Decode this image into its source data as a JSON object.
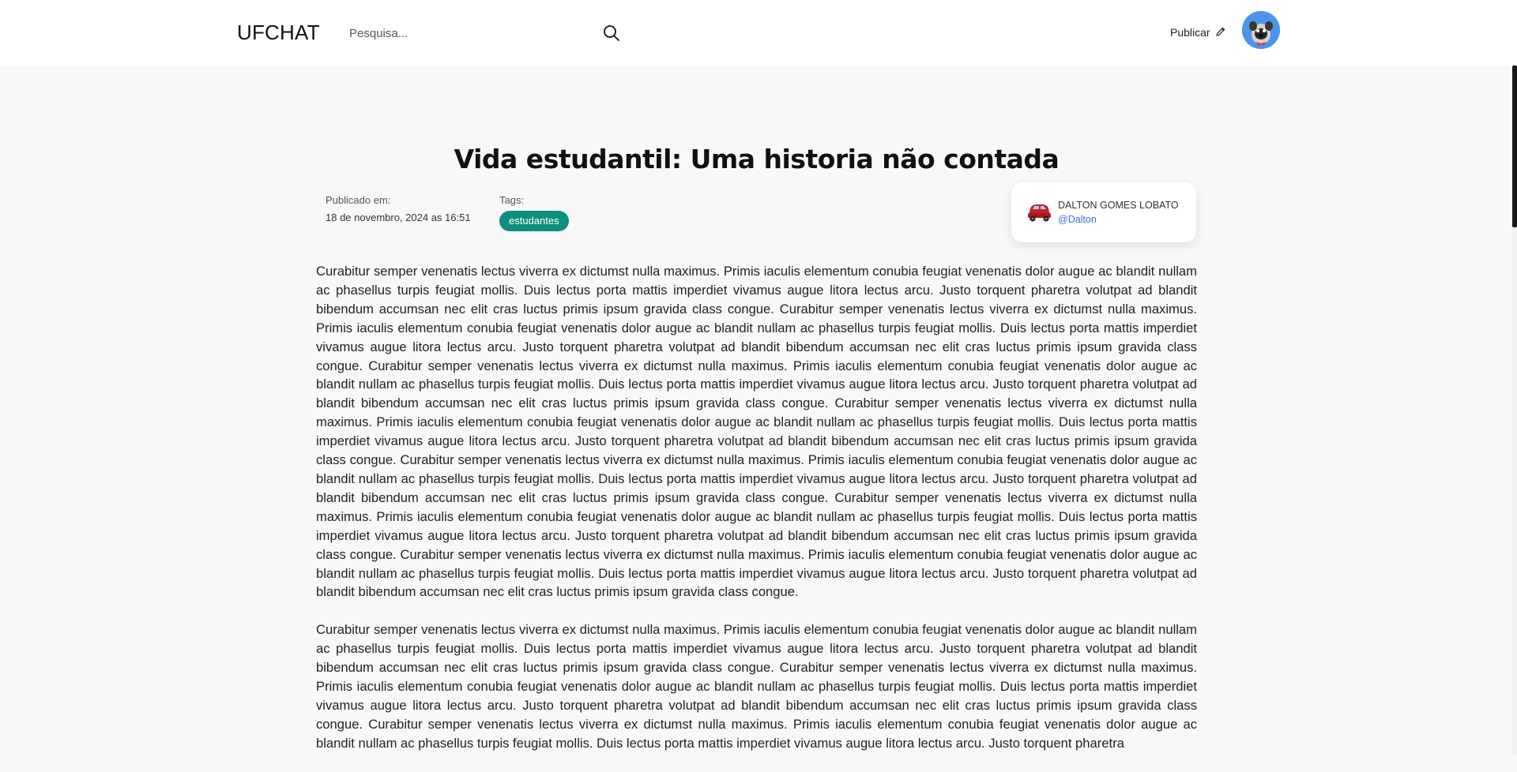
{
  "header": {
    "logo": "UFCHAT",
    "search_placeholder": "Pesquisa...",
    "publish_label": "Publicar"
  },
  "post": {
    "title": "Vida estudantil: Uma historia não contada",
    "published_label": "Publicado em:",
    "published_date": "18 de novembro, 2024 as 16:51",
    "tags_label": "Tags:",
    "tags": [
      "estudantes"
    ],
    "author": {
      "name": "DALTON GOMES LOBATO",
      "handle": "@Dalton"
    },
    "paragraphs": [
      "Curabitur semper venenatis lectus viverra ex dictumst nulla maximus. Primis iaculis elementum conubia feugiat venenatis dolor augue ac blandit nullam ac phasellus turpis feugiat mollis. Duis lectus porta mattis imperdiet vivamus augue litora lectus arcu. Justo torquent pharetra volutpat ad blandit bibendum accumsan nec elit cras luctus primis ipsum gravida class congue. Curabitur semper venenatis lectus viverra ex dictumst nulla maximus. Primis iaculis elementum conubia feugiat venenatis dolor augue ac blandit nullam ac phasellus turpis feugiat mollis. Duis lectus porta mattis imperdiet vivamus augue litora lectus arcu. Justo torquent pharetra volutpat ad blandit bibendum accumsan nec elit cras luctus primis ipsum gravida class congue. Curabitur semper venenatis lectus viverra ex dictumst nulla maximus. Primis iaculis elementum conubia feugiat venenatis dolor augue ac blandit nullam ac phasellus turpis feugiat mollis. Duis lectus porta mattis imperdiet vivamus augue litora lectus arcu. Justo torquent pharetra volutpat ad blandit bibendum accumsan nec elit cras luctus primis ipsum gravida class congue. Curabitur semper venenatis lectus viverra ex dictumst nulla maximus. Primis iaculis elementum conubia feugiat venenatis dolor augue ac blandit nullam ac phasellus turpis feugiat mollis. Duis lectus porta mattis imperdiet vivamus augue litora lectus arcu. Justo torquent pharetra volutpat ad blandit bibendum accumsan nec elit cras luctus primis ipsum gravida class congue. Curabitur semper venenatis lectus viverra ex dictumst nulla maximus. Primis iaculis elementum conubia feugiat venenatis dolor augue ac blandit nullam ac phasellus turpis feugiat mollis. Duis lectus porta mattis imperdiet vivamus augue litora lectus arcu. Justo torquent pharetra volutpat ad blandit bibendum accumsan nec elit cras luctus primis ipsum gravida class congue. Curabitur semper venenatis lectus viverra ex dictumst nulla maximus. Primis iaculis elementum conubia feugiat venenatis dolor augue ac blandit nullam ac phasellus turpis feugiat mollis. Duis lectus porta mattis imperdiet vivamus augue litora lectus arcu. Justo torquent pharetra volutpat ad blandit bibendum accumsan nec elit cras luctus primis ipsum gravida class congue. Curabitur semper venenatis lectus viverra ex dictumst nulla maximus. Primis iaculis elementum conubia feugiat venenatis dolor augue ac blandit nullam ac phasellus turpis feugiat mollis. Duis lectus porta mattis imperdiet vivamus augue litora lectus arcu. Justo torquent pharetra volutpat ad blandit bibendum accumsan nec elit cras luctus primis ipsum gravida class congue.",
      "Curabitur semper venenatis lectus viverra ex dictumst nulla maximus. Primis iaculis elementum conubia feugiat venenatis dolor augue ac blandit nullam ac phasellus turpis feugiat mollis. Duis lectus porta mattis imperdiet vivamus augue litora lectus arcu. Justo torquent pharetra volutpat ad blandit bibendum accumsan nec elit cras luctus primis ipsum gravida class congue. Curabitur semper venenatis lectus viverra ex dictumst nulla maximus. Primis iaculis elementum conubia feugiat venenatis dolor augue ac blandit nullam ac phasellus turpis feugiat mollis. Duis lectus porta mattis imperdiet vivamus augue litora lectus arcu. Justo torquent pharetra volutpat ad blandit bibendum accumsan nec elit cras luctus primis ipsum gravida class congue. Curabitur semper venenatis lectus viverra ex dictumst nulla maximus. Primis iaculis elementum conubia feugiat venenatis dolor augue ac blandit nullam ac phasellus turpis feugiat mollis. Duis lectus porta mattis imperdiet vivamus augue litora lectus arcu. Justo torquent pharetra"
    ]
  },
  "colors": {
    "tag_bg": "#0d8f80",
    "handle": "#3b6fd6",
    "avatar_bg": "#4c95ec",
    "page_bg": "#f8f8f8"
  },
  "icons": {
    "search": "search-icon",
    "publish": "pencil-icon",
    "author": "car-icon"
  }
}
